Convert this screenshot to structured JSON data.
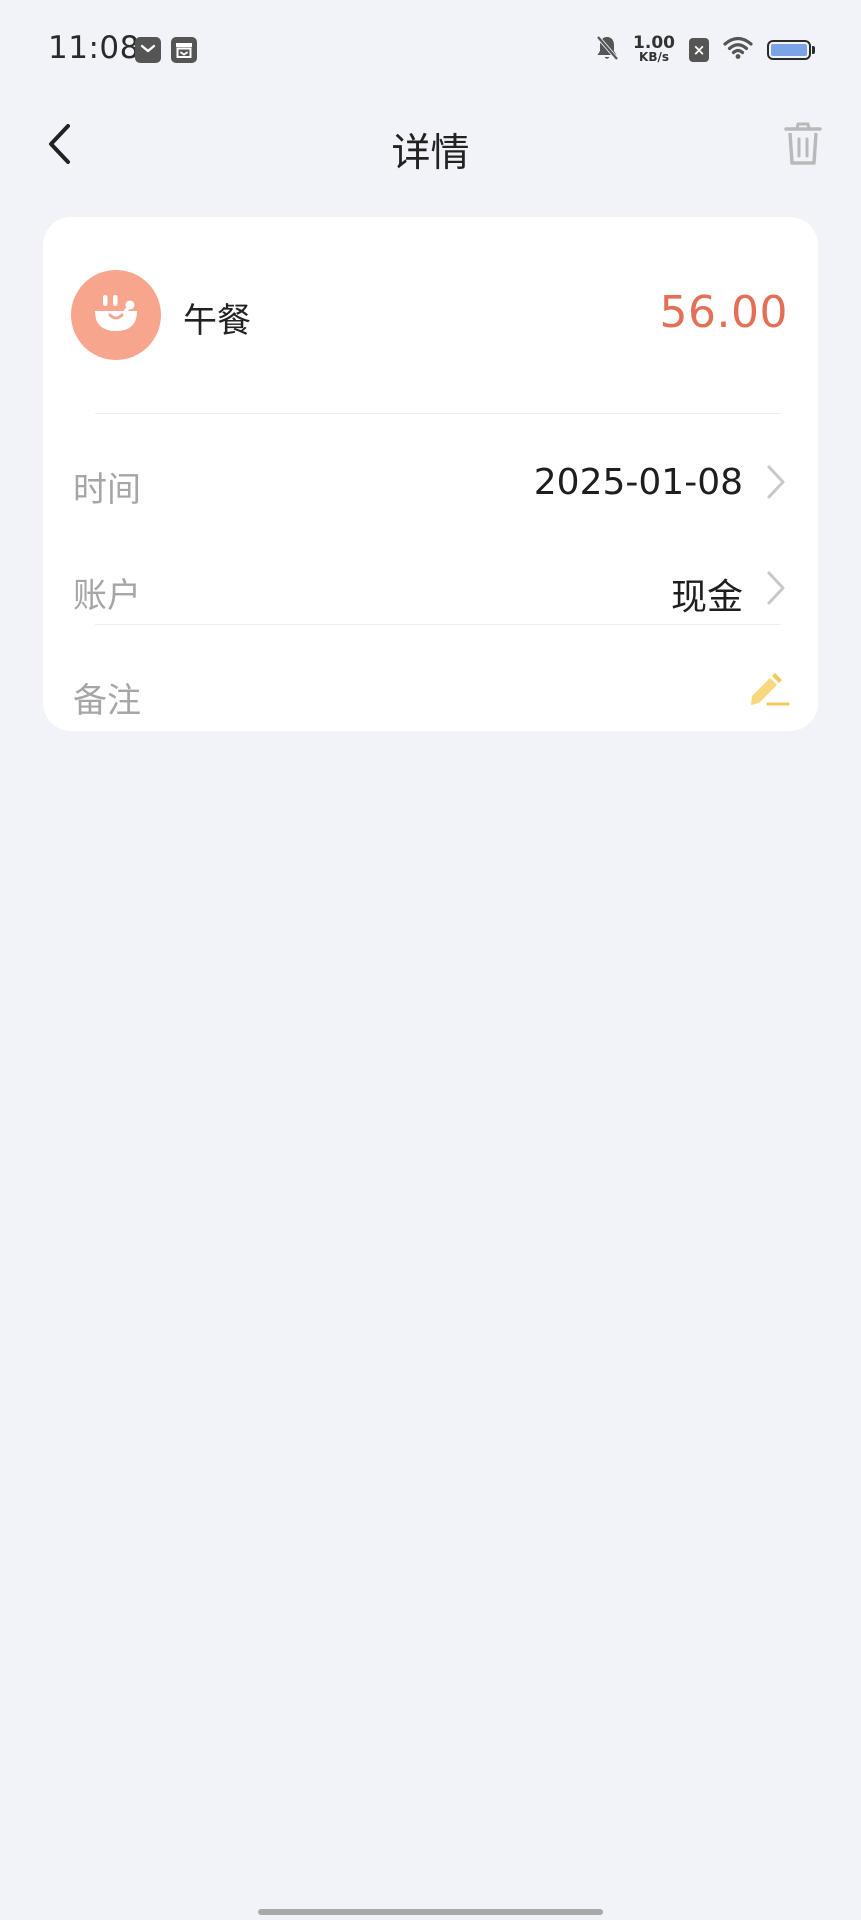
{
  "status_bar": {
    "time": "11:08",
    "net_speed_value": "1.00",
    "net_speed_unit": "KB/s",
    "sim_status": "×",
    "icons": [
      "message-icon",
      "archive-icon",
      "bell-muted-icon",
      "sim-off-icon",
      "wifi-icon",
      "battery-icon"
    ]
  },
  "header": {
    "title": "详情"
  },
  "record": {
    "category": "午餐",
    "category_icon": "bowl-icon",
    "amount": "56.00",
    "amount_color": "#e46f56",
    "avatar_color": "#f8a58d"
  },
  "details": {
    "time_label": "时间",
    "time_value": "2025-01-08",
    "account_label": "账户",
    "account_value": "现金",
    "note_label": "备注"
  },
  "colors": {
    "background": "#f1f3f8",
    "card": "#ffffff",
    "label": "#a6a6a6",
    "edit_icon": "#f6c75a"
  }
}
